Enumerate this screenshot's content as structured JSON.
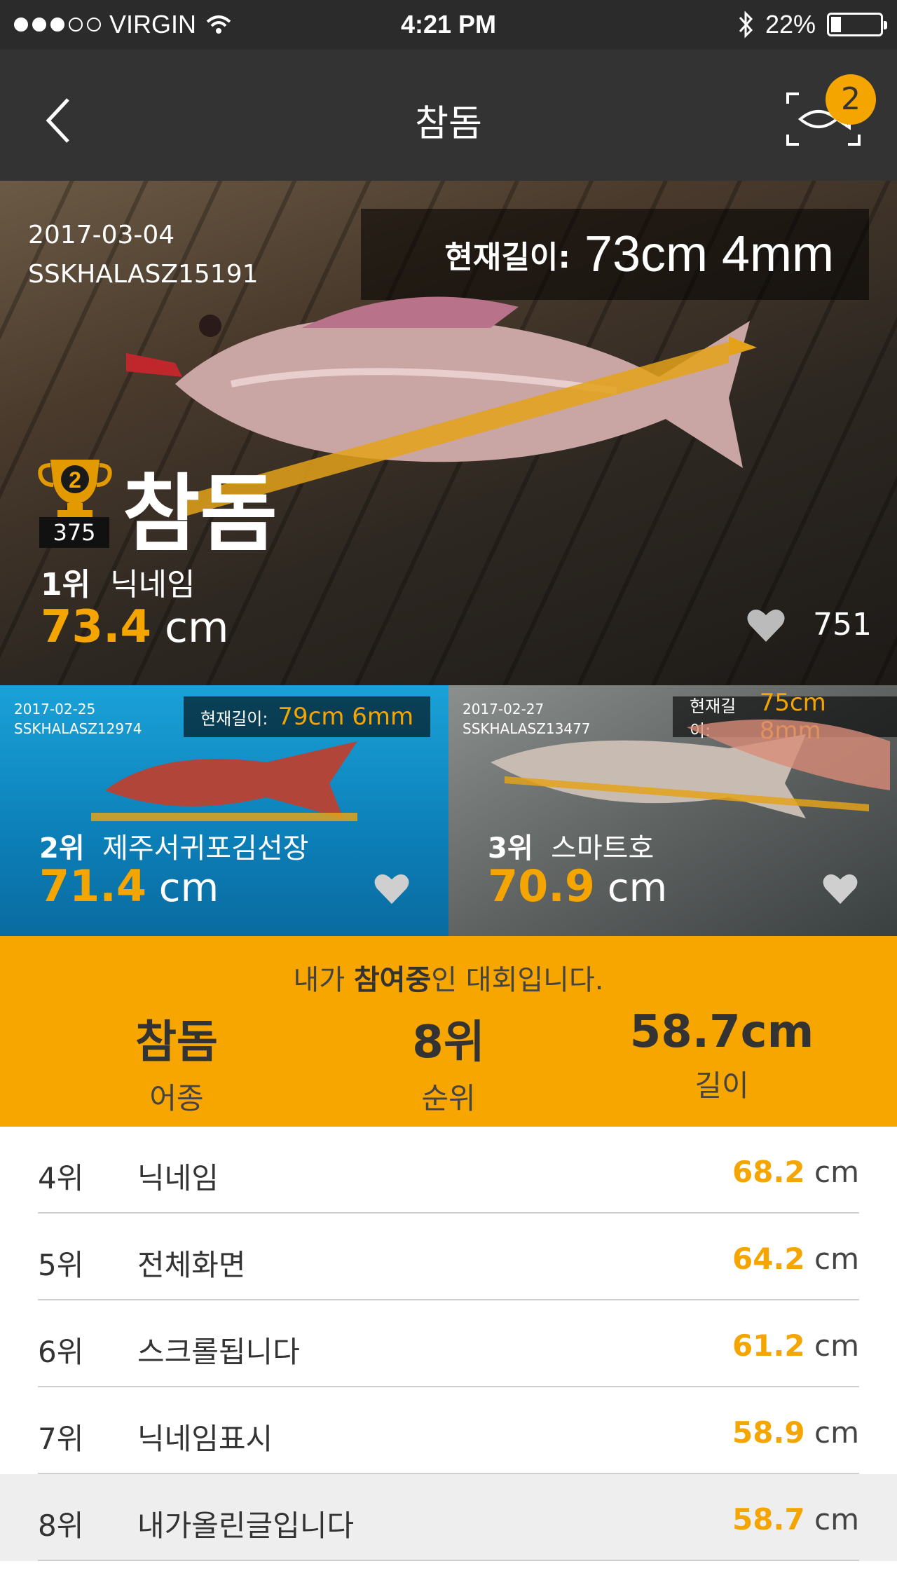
{
  "status_bar": {
    "carrier": "VIRGIN",
    "time": "4:21 PM",
    "battery": "22%",
    "signal_dots_filled": 3,
    "signal_dots_total": 5
  },
  "nav": {
    "title": "참돔",
    "badge_count": "2",
    "icons": [
      "back-chevron-icon",
      "fish-scan-icon"
    ]
  },
  "hero": {
    "date": "2017-03-04",
    "code": "SSKHALASZ15191",
    "length_label": "현재길이:",
    "length_value": "73cm 4mm",
    "trophy_rank": "2",
    "entry_count": "375",
    "species": "참돔",
    "rank": "1위",
    "nickname": "닉네임",
    "length_num": "73.4",
    "length_unit": "cm",
    "likes": "751"
  },
  "cards": [
    {
      "date": "2017-02-25",
      "code": "SSKHALASZ12974",
      "length_label": "현재길이:",
      "length_value": "79cm 6mm",
      "rank": "2위",
      "nickname": "제주서귀포김선장",
      "length_num": "71.4",
      "length_unit": "cm"
    },
    {
      "date": "2017-02-27",
      "code": "SSKHALASZ13477",
      "length_label": "현재길이:",
      "length_value": "75cm 8mm",
      "rank": "3위",
      "nickname": "스마트호",
      "length_num": "70.9",
      "length_unit": "cm"
    }
  ],
  "participation": {
    "msg_pre": "내가 ",
    "msg_bold": "참여중",
    "msg_post": "인 대회입니다.",
    "species_value": "참돔",
    "species_label": "어종",
    "rank_value": "8위",
    "rank_label": "순위",
    "length_value": "58.7cm",
    "length_label": "길이"
  },
  "ranking": [
    {
      "rank": "4위",
      "name": "닉네임",
      "num": "68.2",
      "unit": "cm"
    },
    {
      "rank": "5위",
      "name": "전체화면",
      "num": "64.2",
      "unit": "cm"
    },
    {
      "rank": "6위",
      "name": "스크롤됩니다",
      "num": "61.2",
      "unit": "cm"
    },
    {
      "rank": "7위",
      "name": "닉네임표시",
      "num": "58.9",
      "unit": "cm"
    },
    {
      "rank": "8위",
      "name": "내가올린글입니다",
      "num": "58.7",
      "unit": "cm"
    }
  ],
  "colors": {
    "accent": "#f5a500",
    "banner": "#f7a600",
    "navbar": "#333333",
    "highlight_row": "#eeeeee"
  }
}
